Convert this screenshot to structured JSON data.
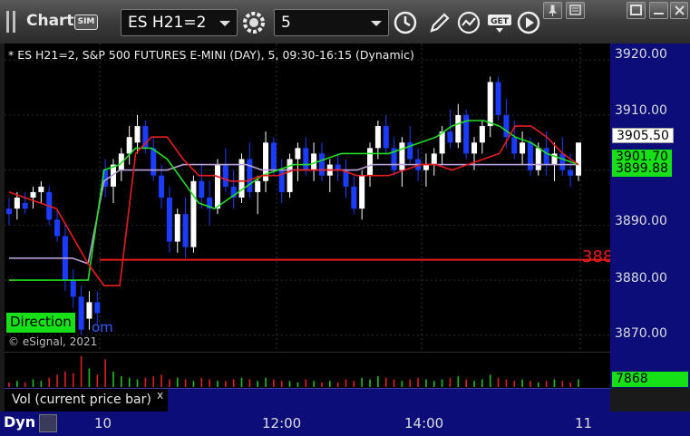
{
  "toolbar": {
    "title": "Chart",
    "sim_badge": "SIM",
    "symbol": "ES H21=2",
    "interval": "5",
    "icons": [
      "settings-gear-icon",
      "clock-icon",
      "pencil-icon",
      "study-icon",
      "get-icon",
      "play-icon",
      "pin-icon",
      "restore-icon",
      "maximize-icon",
      "close-icon"
    ]
  },
  "chart": {
    "header": "* ES H21=2, S&P 500 FUTURES E-MINI (DAY), 5, 09:30-16:15 (Dynamic)",
    "copyright": "© eSignal, 2021",
    "direction_label": "Direction",
    "direction_tail": "om",
    "level_label": "388",
    "colors": {
      "bull": "#ffffff",
      "bear": "#1a3cff",
      "ma_red": "#e81c1c",
      "ma_green": "#21e021",
      "ma_purple": "#b8a0d8"
    }
  },
  "price_axis": {
    "ticks": [
      "3920.00",
      "3910.00",
      "3900.00",
      "3890.00",
      "3880.00",
      "3870.00"
    ],
    "last_price": "3905.50",
    "green_tag_1": "3901.70",
    "green_tag_2": "3899.88"
  },
  "volume": {
    "label": "Vol (current price bar)",
    "close": "x",
    "value": "7868"
  },
  "time_axis": {
    "dyn_label": "Dyn",
    "ticks": [
      "10",
      "12:00",
      "14:00",
      "11"
    ]
  },
  "chart_data": {
    "type": "candlestick",
    "y_range": [
      3867,
      3923
    ],
    "candles": [
      [
        3893,
        3895,
        3890,
        3892
      ],
      [
        3893,
        3896,
        3891,
        3895
      ],
      [
        3894,
        3896,
        3892,
        3893
      ],
      [
        3895,
        3897,
        3893,
        3896
      ],
      [
        3896,
        3898,
        3894,
        3897
      ],
      [
        3896,
        3897,
        3890,
        3891
      ],
      [
        3891,
        3893,
        3887,
        3888
      ],
      [
        3888,
        3890,
        3878,
        3880
      ],
      [
        3880,
        3882,
        3875,
        3877
      ],
      [
        3877,
        3879,
        3870,
        3871
      ],
      [
        3873,
        3878,
        3871,
        3876
      ],
      [
        3876,
        3878,
        3872,
        3874
      ],
      [
        3900,
        3902,
        3895,
        3897
      ],
      [
        3897,
        3902,
        3894,
        3901
      ],
      [
        3900,
        3904,
        3898,
        3903
      ],
      [
        3903,
        3908,
        3901,
        3906
      ],
      [
        3905,
        3910,
        3903,
        3908
      ],
      [
        3908,
        3909,
        3903,
        3904
      ],
      [
        3904,
        3906,
        3898,
        3899
      ],
      [
        3899,
        3901,
        3893,
        3895
      ],
      [
        3895,
        3897,
        3885,
        3887
      ],
      [
        3887,
        3893,
        3885,
        3892
      ],
      [
        3892,
        3895,
        3884,
        3886
      ],
      [
        3886,
        3899,
        3885,
        3898
      ],
      [
        3898,
        3901,
        3893,
        3895
      ],
      [
        3895,
        3898,
        3890,
        3893
      ],
      [
        3893,
        3902,
        3892,
        3901
      ],
      [
        3901,
        3904,
        3896,
        3897
      ],
      [
        3897,
        3900,
        3893,
        3895
      ],
      [
        3895,
        3903,
        3894,
        3902
      ],
      [
        3902,
        3905,
        3895,
        3896
      ],
      [
        3896,
        3899,
        3892,
        3898
      ],
      [
        3898,
        3907,
        3896,
        3905
      ],
      [
        3905,
        3906,
        3899,
        3900
      ],
      [
        3900,
        3902,
        3894,
        3896
      ],
      [
        3896,
        3903,
        3895,
        3902
      ],
      [
        3902,
        3905,
        3898,
        3904
      ],
      [
        3904,
        3906,
        3899,
        3900
      ],
      [
        3900,
        3905,
        3898,
        3903
      ],
      [
        3903,
        3905,
        3898,
        3899
      ],
      [
        3899,
        3902,
        3896,
        3901
      ],
      [
        3901,
        3903,
        3898,
        3900
      ],
      [
        3900,
        3902,
        3895,
        3897
      ],
      [
        3897,
        3899,
        3892,
        3893
      ],
      [
        3893,
        3900,
        3891,
        3899
      ],
      [
        3899,
        3905,
        3897,
        3904
      ],
      [
        3904,
        3909,
        3902,
        3908
      ],
      [
        3908,
        3910,
        3903,
        3904
      ],
      [
        3904,
        3906,
        3899,
        3900
      ],
      [
        3900,
        3906,
        3897,
        3905
      ],
      [
        3905,
        3908,
        3901,
        3902
      ],
      [
        3902,
        3904,
        3898,
        3900
      ],
      [
        3900,
        3903,
        3897,
        3901
      ],
      [
        3901,
        3904,
        3899,
        3903
      ],
      [
        3903,
        3908,
        3901,
        3907
      ],
      [
        3907,
        3911,
        3904,
        3905
      ],
      [
        3905,
        3912,
        3904,
        3910
      ],
      [
        3910,
        3911,
        3902,
        3903
      ],
      [
        3903,
        3906,
        3900,
        3905
      ],
      [
        3905,
        3909,
        3903,
        3908
      ],
      [
        3908,
        3917,
        3906,
        3916
      ],
      [
        3916,
        3917,
        3909,
        3910
      ],
      [
        3910,
        3913,
        3904,
        3906
      ],
      [
        3906,
        3909,
        3902,
        3903
      ],
      [
        3903,
        3907,
        3901,
        3905
      ],
      [
        3905,
        3906,
        3899,
        3900
      ],
      [
        3900,
        3905,
        3899,
        3904
      ],
      [
        3904,
        3907,
        3899,
        3901
      ],
      [
        3901,
        3905,
        3898,
        3903
      ],
      [
        3903,
        3906,
        3899,
        3900
      ],
      [
        3900,
        3903,
        3897,
        3899
      ],
      [
        3899,
        3905,
        3898,
        3905
      ]
    ],
    "ma_red": [
      3896,
      3895,
      3894,
      3893,
      3888,
      3883,
      3879,
      3879,
      3903,
      3906,
      3906,
      3902,
      3899,
      3899,
      3898,
      3898,
      3899,
      3899,
      3900,
      3900,
      3900,
      3900,
      3899,
      3899,
      3899,
      3900,
      3901,
      3901,
      3900,
      3901,
      3902,
      3903,
      3908,
      3908,
      3906,
      3903,
      3901
    ],
    "ma_green": [
      3880,
      3880,
      3880,
      3880,
      3880,
      3880,
      3900,
      3901,
      3904,
      3904,
      3902,
      3898,
      3894,
      3893,
      3895,
      3897,
      3899,
      3900,
      3901,
      3901,
      3902,
      3903,
      3903,
      3903,
      3903,
      3904,
      3905,
      3906,
      3908,
      3909,
      3909,
      3908,
      3906,
      3905,
      3903,
      3902,
      3901
    ],
    "ma_purple": [
      3884,
      3884,
      3884,
      3884,
      3884,
      3883,
      3898,
      3900,
      3900,
      3900,
      3900,
      3901,
      3901,
      3901,
      3901,
      3901,
      3900,
      3900,
      3900,
      3900,
      3900,
      3900,
      3900,
      3901,
      3901,
      3901,
      3901,
      3901,
      3901,
      3901,
      3901,
      3901,
      3901,
      3901,
      3901,
      3901,
      3901
    ],
    "level_line": 3883.7,
    "volumes": [
      3,
      4,
      3,
      5,
      4,
      6,
      8,
      10,
      9,
      20,
      12,
      8,
      18,
      10,
      7,
      6,
      5,
      6,
      7,
      8,
      5,
      6,
      5,
      4,
      6,
      5,
      4,
      4,
      5,
      6,
      5,
      4,
      6,
      5,
      4,
      4,
      3,
      5,
      4,
      3,
      4,
      3,
      5,
      4,
      6,
      5,
      7,
      6,
      5,
      4,
      5,
      6,
      5,
      4,
      5,
      6,
      7,
      5,
      4,
      5,
      8,
      6,
      5,
      4,
      5,
      4,
      3,
      4,
      5,
      4,
      3,
      5
    ]
  }
}
